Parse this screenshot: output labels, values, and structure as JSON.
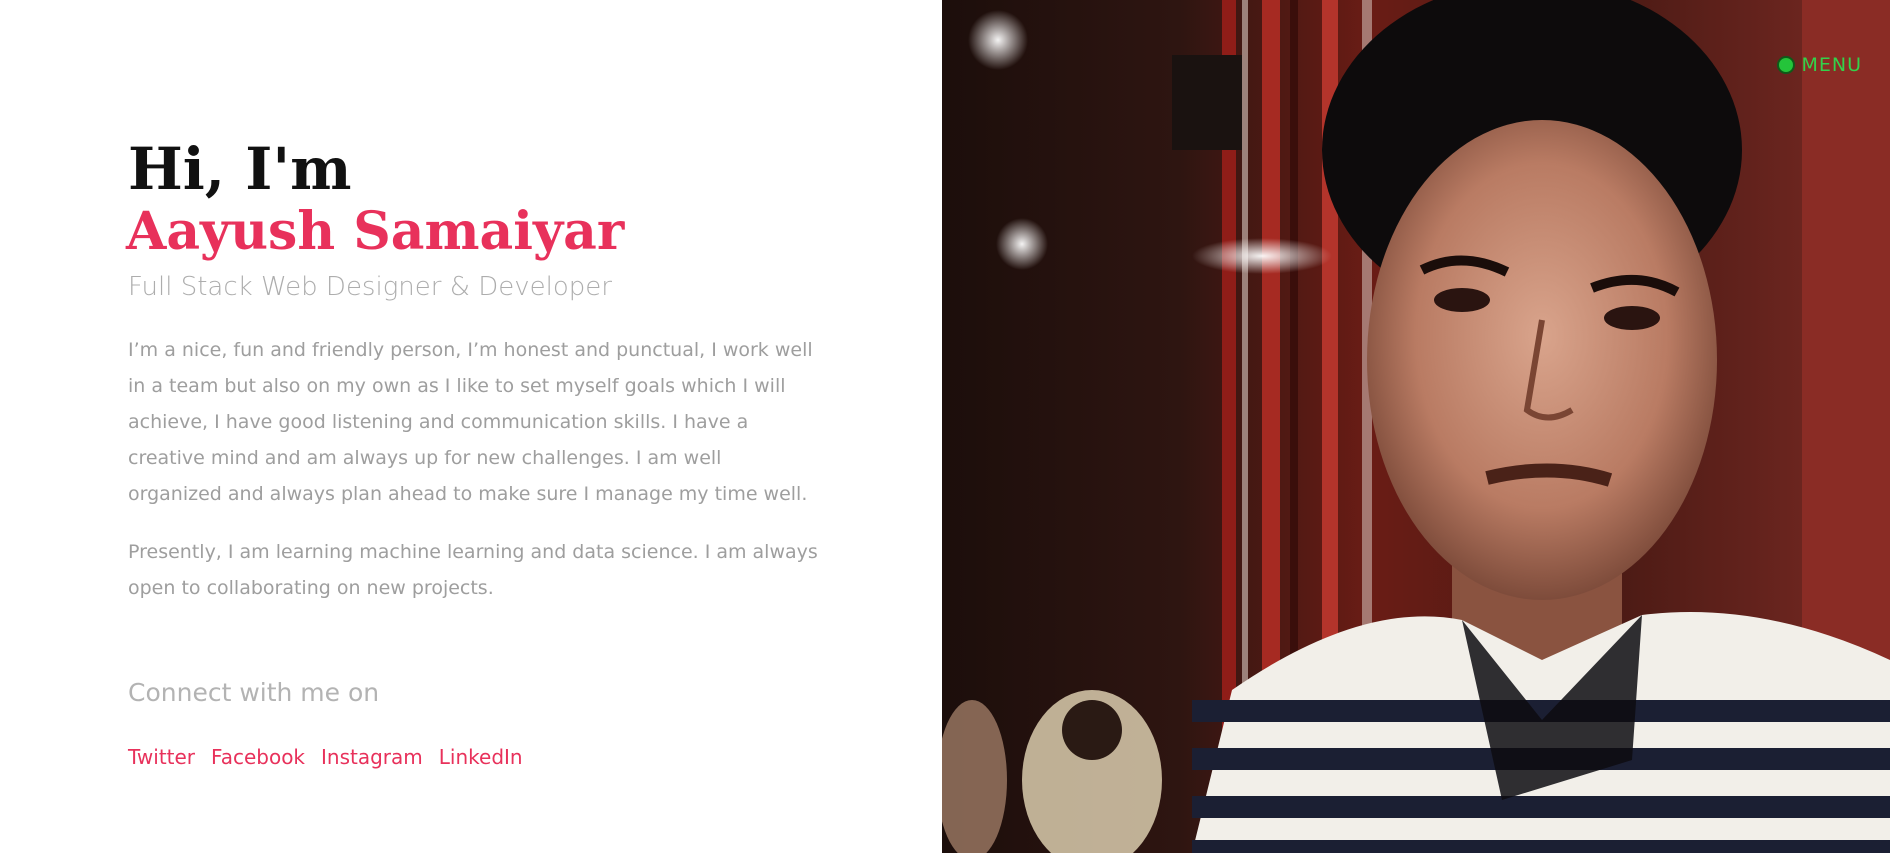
{
  "hero": {
    "greeting": "Hi, I'm",
    "name": "Aayush Samaiyar",
    "role": "Full Stack Web Designer & Developer",
    "bio_paragraph_1": "I’m a nice, fun and friendly person, I’m honest and punctual, I work well in a team but also on my own as I like to set myself goals which I will achieve, I have good listening and communication skills. I have a creative mind and am always up for new challenges. I am well organized and always plan ahead to make sure I manage my time well.",
    "bio_paragraph_2": "Presently, I am learning machine learning and data science. I am always open to collaborating on new projects."
  },
  "connect": {
    "heading": "Connect with me on",
    "links": [
      {
        "label": "Twitter"
      },
      {
        "label": "Facebook"
      },
      {
        "label": "Instagram"
      },
      {
        "label": "LinkedIn"
      }
    ]
  },
  "nav": {
    "menu_label": "MENU",
    "menu_icon": "green-dot-icon"
  },
  "colors": {
    "accent": "#e8315b",
    "menu_green": "#24c43a",
    "body_text": "#9e9e9e"
  },
  "photo": {
    "subject": "portrait-photo"
  }
}
